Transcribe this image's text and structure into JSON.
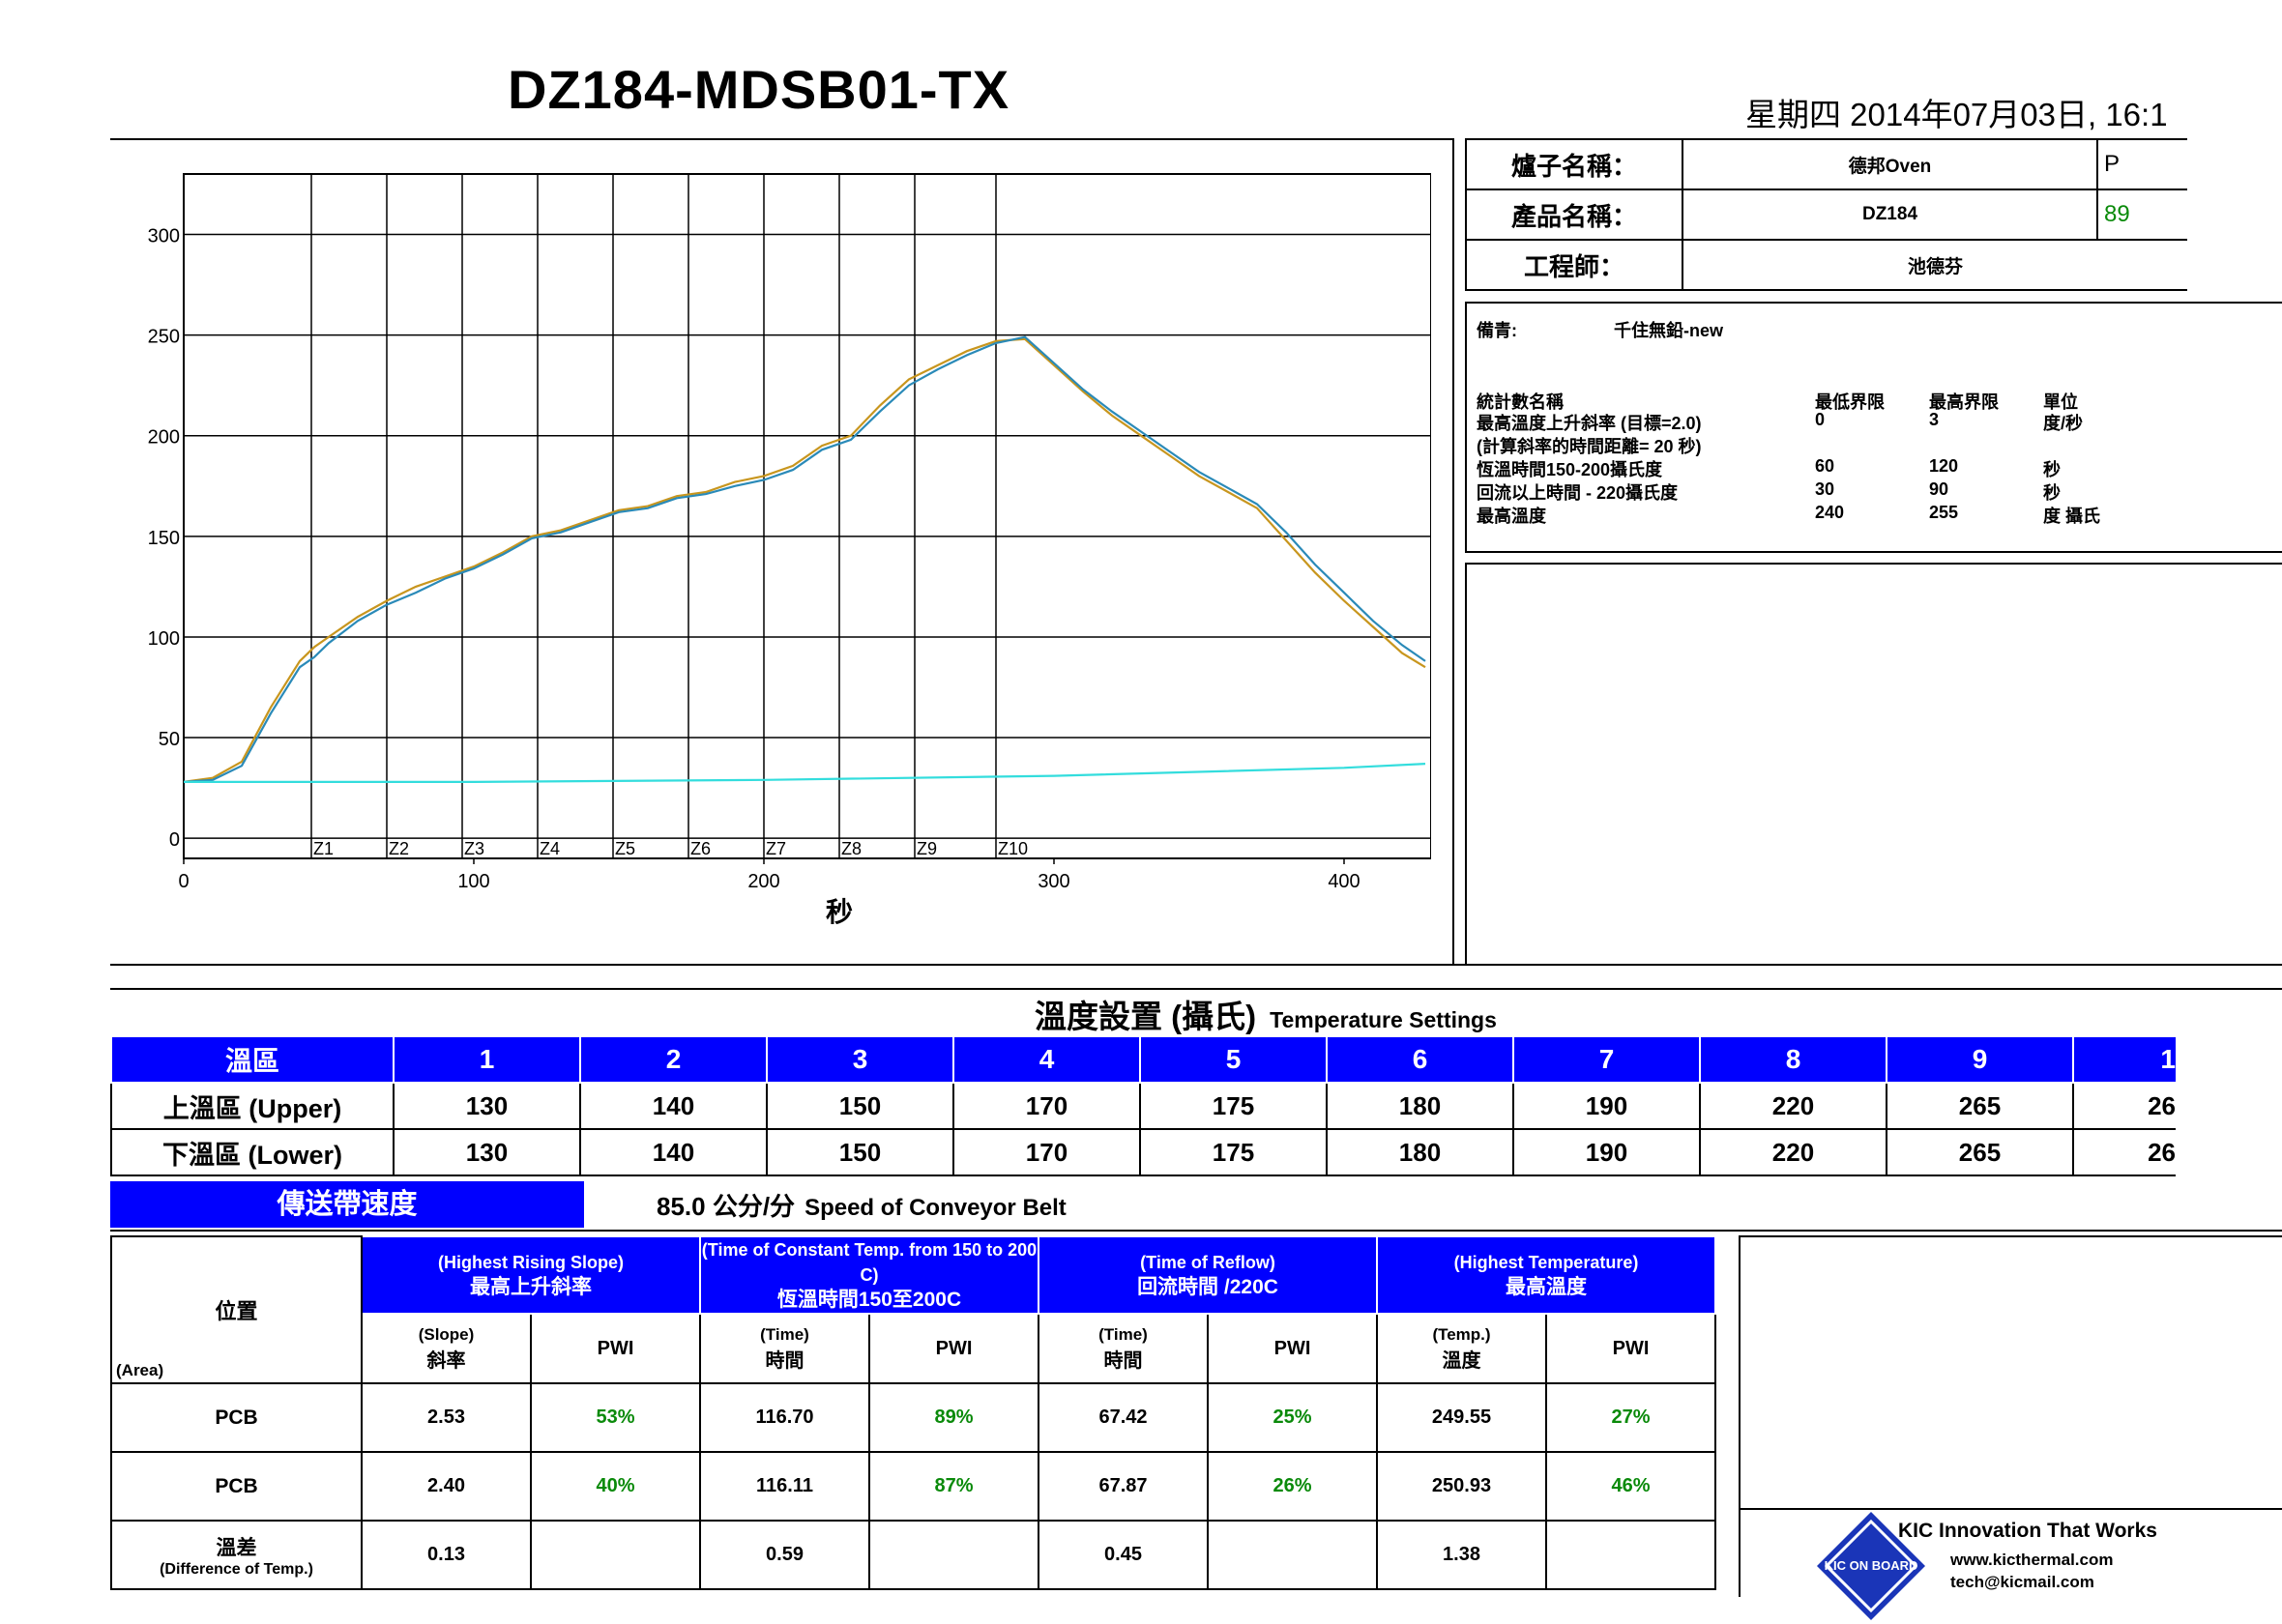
{
  "header": {
    "title": "DZ184-MDSB01-TX",
    "date": "星期四 2014年07月03日, 16:1"
  },
  "info": {
    "oven_label": "爐子名稱：",
    "oven_value": "德邦Oven",
    "oven_extra": "P",
    "product_label": "產品名稱：",
    "product_value": "DZ184",
    "product_extra": "89",
    "engineer_label": "工程師：",
    "engineer_value": "池德芬"
  },
  "notes": {
    "label": "備青:",
    "text": "千住無鉛-new",
    "col_headers": [
      "統計數名稱",
      "最低界限",
      "最高界限",
      "單位"
    ],
    "rows": [
      {
        "name": "最高溫度上升斜率 (目標=2.0)",
        "low": "0",
        "high": "3",
        "unit": "度/秒"
      },
      {
        "name": "(計算斜率的時間距離= 20 秒)",
        "low": "",
        "high": "",
        "unit": ""
      },
      {
        "name": "恆溫時間150-200攝氏度",
        "low": "60",
        "high": "120",
        "unit": "秒"
      },
      {
        "name": "回流以上時間 - 220攝氏度",
        "low": "30",
        "high": "90",
        "unit": "秒"
      },
      {
        "name": "最高溫度",
        "low": "240",
        "high": "255",
        "unit": "度 攝氏"
      }
    ]
  },
  "chart_data": {
    "type": "line",
    "xlabel": "秒",
    "ylabel": "",
    "xlim": [
      0,
      430
    ],
    "ylim": [
      -10,
      330
    ],
    "x_ticks": [
      0,
      100,
      200,
      300,
      400
    ],
    "y_ticks": [
      0,
      50,
      100,
      150,
      200,
      250,
      300
    ],
    "zone_labels": [
      "Z1",
      "Z2",
      "Z3",
      "Z4",
      "Z5",
      "Z6",
      "Z7",
      "Z8",
      "Z9",
      "Z10"
    ],
    "zone_boundaries": [
      44,
      70,
      96,
      122,
      148,
      174,
      200,
      226,
      252,
      280
    ],
    "grid": true,
    "series": [
      {
        "color": "#c8961e",
        "x": [
          0,
          10,
          20,
          30,
          40,
          45,
          50,
          60,
          70,
          80,
          90,
          100,
          110,
          120,
          130,
          140,
          150,
          160,
          170,
          180,
          190,
          200,
          210,
          220,
          230,
          240,
          250,
          260,
          270,
          280,
          290,
          300,
          310,
          320,
          330,
          340,
          350,
          360,
          370,
          380,
          390,
          400,
          410,
          420,
          428
        ],
        "y": [
          28,
          30,
          38,
          65,
          88,
          95,
          100,
          110,
          118,
          125,
          130,
          135,
          142,
          150,
          153,
          158,
          163,
          165,
          170,
          172,
          177,
          180,
          185,
          195,
          200,
          215,
          228,
          235,
          242,
          247,
          248,
          235,
          222,
          210,
          200,
          190,
          180,
          172,
          164,
          148,
          132,
          118,
          105,
          92,
          85
        ]
      },
      {
        "color": "#2a8ab8",
        "x": [
          0,
          10,
          20,
          30,
          40,
          45,
          50,
          60,
          70,
          80,
          90,
          100,
          110,
          120,
          130,
          140,
          150,
          160,
          170,
          180,
          190,
          200,
          210,
          220,
          230,
          240,
          250,
          260,
          270,
          280,
          290,
          300,
          310,
          320,
          330,
          340,
          350,
          360,
          370,
          380,
          390,
          400,
          410,
          420,
          428
        ],
        "y": [
          28,
          29,
          36,
          62,
          85,
          90,
          97,
          108,
          116,
          122,
          129,
          134,
          141,
          149,
          152,
          157,
          162,
          164,
          169,
          171,
          175,
          178,
          183,
          193,
          198,
          212,
          225,
          233,
          240,
          246,
          249,
          236,
          223,
          212,
          202,
          192,
          182,
          174,
          166,
          152,
          136,
          122,
          108,
          96,
          88
        ]
      },
      {
        "color": "#33dddd",
        "x": [
          0,
          100,
          200,
          300,
          400,
          428
        ],
        "y": [
          28,
          28,
          29,
          31,
          35,
          37
        ]
      }
    ]
  },
  "temp_settings": {
    "title_zh": "溫度設置 (攝氏)",
    "title_en": "Temperature Settings",
    "header_label": "溫區",
    "zones": [
      "1",
      "2",
      "3",
      "4",
      "5",
      "6",
      "7",
      "8",
      "9",
      "1"
    ],
    "upper_label": "上溫區 (Upper)",
    "upper": [
      "130",
      "140",
      "150",
      "170",
      "175",
      "180",
      "190",
      "220",
      "265",
      "26"
    ],
    "lower_label": "下溫區 (Lower)",
    "lower": [
      "130",
      "140",
      "150",
      "170",
      "175",
      "180",
      "190",
      "220",
      "265",
      "26"
    ],
    "conveyor_label": "傳送帶速度",
    "conveyor_value": "85.0 公分/分",
    "conveyor_en": "Speed of Conveyor Belt"
  },
  "results": {
    "area_label": "位置",
    "area_en": "(Area)",
    "groups": [
      {
        "en": "(Highest Rising Slope)",
        "zh": "最高上升斜率"
      },
      {
        "en": "(Time of Constant Temp. from 150 to 200 C)",
        "zh": "恆溫時間150至200C"
      },
      {
        "en": "(Time of Reflow)",
        "zh": "回流時間 /220C"
      },
      {
        "en": "(Highest Temperature)",
        "zh": "最高溫度"
      }
    ],
    "subheads": [
      {
        "en": "(Slope)",
        "zh": "斜率"
      },
      {
        "en": "",
        "zh": "PWI"
      },
      {
        "en": "(Time)",
        "zh": "時間"
      },
      {
        "en": "",
        "zh": "PWI"
      },
      {
        "en": "(Time)",
        "zh": "時間"
      },
      {
        "en": "",
        "zh": "PWI"
      },
      {
        "en": "(Temp.)",
        "zh": "溫度"
      },
      {
        "en": "",
        "zh": "PWI"
      }
    ],
    "rows": [
      {
        "area": "PCB",
        "cells": [
          "2.53",
          "53%",
          "116.70",
          "89%",
          "67.42",
          "25%",
          "249.55",
          "27%"
        ]
      },
      {
        "area": "PCB",
        "cells": [
          "2.40",
          "40%",
          "116.11",
          "87%",
          "67.87",
          "26%",
          "250.93",
          "46%"
        ]
      }
    ],
    "diff_label": "溫差",
    "diff_en": "(Difference of Temp.)",
    "diff_cells": [
      "0.13",
      "",
      "0.59",
      "",
      "0.45",
      "",
      "1.38",
      ""
    ]
  },
  "footer": {
    "logo_text": "KIC ON BOARD",
    "tagline": "KIC Innovation That Works",
    "site": "www.kicthermal.com",
    "email": "tech@kicmail.com"
  }
}
